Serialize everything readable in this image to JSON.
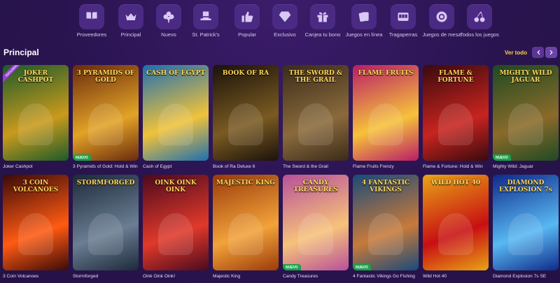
{
  "categories": [
    {
      "label": "Proveedores",
      "icon": "book-icon"
    },
    {
      "label": "Principal",
      "icon": "crown-icon"
    },
    {
      "label": "Nuevo",
      "icon": "clover-icon"
    },
    {
      "label": "St. Patrick's",
      "icon": "hat-icon"
    },
    {
      "label": "Popular",
      "icon": "thumbs-up-icon"
    },
    {
      "label": "Exclusivo",
      "icon": "diamond-icon"
    },
    {
      "label": "Canjea tu bono",
      "icon": "gift-icon"
    },
    {
      "label": "Juegos en línea",
      "icon": "cards-icon"
    },
    {
      "label": "Tragaperras",
      "icon": "slot-machine-icon"
    },
    {
      "label": "Juegos de mesa",
      "icon": "chip-icon"
    },
    {
      "label": "Todos los juegos",
      "icon": "cherries-icon"
    }
  ],
  "section": {
    "title": "Principal",
    "see_all": "Ver todo"
  },
  "games": [
    {
      "name": "Joker Cashpot",
      "logo": "JOKER CASHPOT",
      "badge": "",
      "exclusive": "EXCLUSIVO",
      "colors": [
        "#1c5a2a",
        "#c99a1c"
      ]
    },
    {
      "name": "3 Pyramids of Gold: Hold & Win",
      "logo": "3 PYRAMIDS OF GOLD",
      "badge": "NUEVO",
      "exclusive": "",
      "colors": [
        "#6a2a0e",
        "#e2a326"
      ]
    },
    {
      "name": "Cash of Egypt",
      "logo": "CASH OF EGYPT",
      "badge": "",
      "exclusive": "",
      "colors": [
        "#1e6fb0",
        "#f0c23a"
      ]
    },
    {
      "name": "Book of Ra Deluxe 6",
      "logo": "BOOK OF RA",
      "badge": "",
      "exclusive": "",
      "colors": [
        "#1a120a",
        "#7a5a22"
      ]
    },
    {
      "name": "The Sword & the Grail",
      "logo": "THE SWORD & THE GRAIL",
      "badge": "",
      "exclusive": "",
      "colors": [
        "#3a2b1a",
        "#8a6a3c"
      ]
    },
    {
      "name": "Flame Fruits Frenzy",
      "logo": "FLAME FRUITS",
      "badge": "",
      "exclusive": "",
      "colors": [
        "#b91c68",
        "#f6c23a"
      ]
    },
    {
      "name": "Flame & Fortune: Hold & Win",
      "logo": "FLAME & FORTUNE",
      "badge": "",
      "exclusive": "",
      "colors": [
        "#3a0a0e",
        "#c7241f"
      ]
    },
    {
      "name": "Mighty Wild: Jaguar",
      "logo": "MIGHTY WILD JAGUAR",
      "badge": "NUEVO",
      "exclusive": "",
      "colors": [
        "#1d4a22",
        "#8a6a2a"
      ]
    },
    {
      "name": "3 Coin Volcanoes",
      "logo": "3 COIN VOLCANOES",
      "badge": "",
      "exclusive": "",
      "colors": [
        "#3a0a08",
        "#ff5a12"
      ]
    },
    {
      "name": "Stormforged",
      "logo": "STORMFORGED",
      "badge": "",
      "exclusive": "",
      "colors": [
        "#1c2a3a",
        "#6a7d92"
      ]
    },
    {
      "name": "Oink Oink Oink!",
      "logo": "OINK OINK OINK",
      "badge": "",
      "exclusive": "",
      "colors": [
        "#4a0a1e",
        "#e0392a"
      ]
    },
    {
      "name": "Majestic King",
      "logo": "MAJESTIC KING",
      "badge": "",
      "exclusive": "",
      "colors": [
        "#9a3a0a",
        "#f2a23a"
      ]
    },
    {
      "name": "Candy Treasures",
      "logo": "CANDY TREASURES",
      "badge": "NUEVO",
      "exclusive": "",
      "colors": [
        "#b8509a",
        "#f6c27a"
      ]
    },
    {
      "name": "4 Fantastic Vikings Go Fishing",
      "logo": "4 FANTASTIC VIKINGS",
      "badge": "NUEVO",
      "exclusive": "",
      "colors": [
        "#1a4a7a",
        "#c77a3a"
      ]
    },
    {
      "name": "Wild Hot 40",
      "logo": "WILD HOT 40",
      "badge": "",
      "exclusive": "",
      "colors": [
        "#e8a516",
        "#c80f12"
      ]
    },
    {
      "name": "Diamond Explosion 7s SE",
      "logo": "DIAMOND EXPLOSION 7s",
      "badge": "",
      "exclusive": "",
      "colors": [
        "#0f2a8a",
        "#58b8f2"
      ]
    }
  ]
}
